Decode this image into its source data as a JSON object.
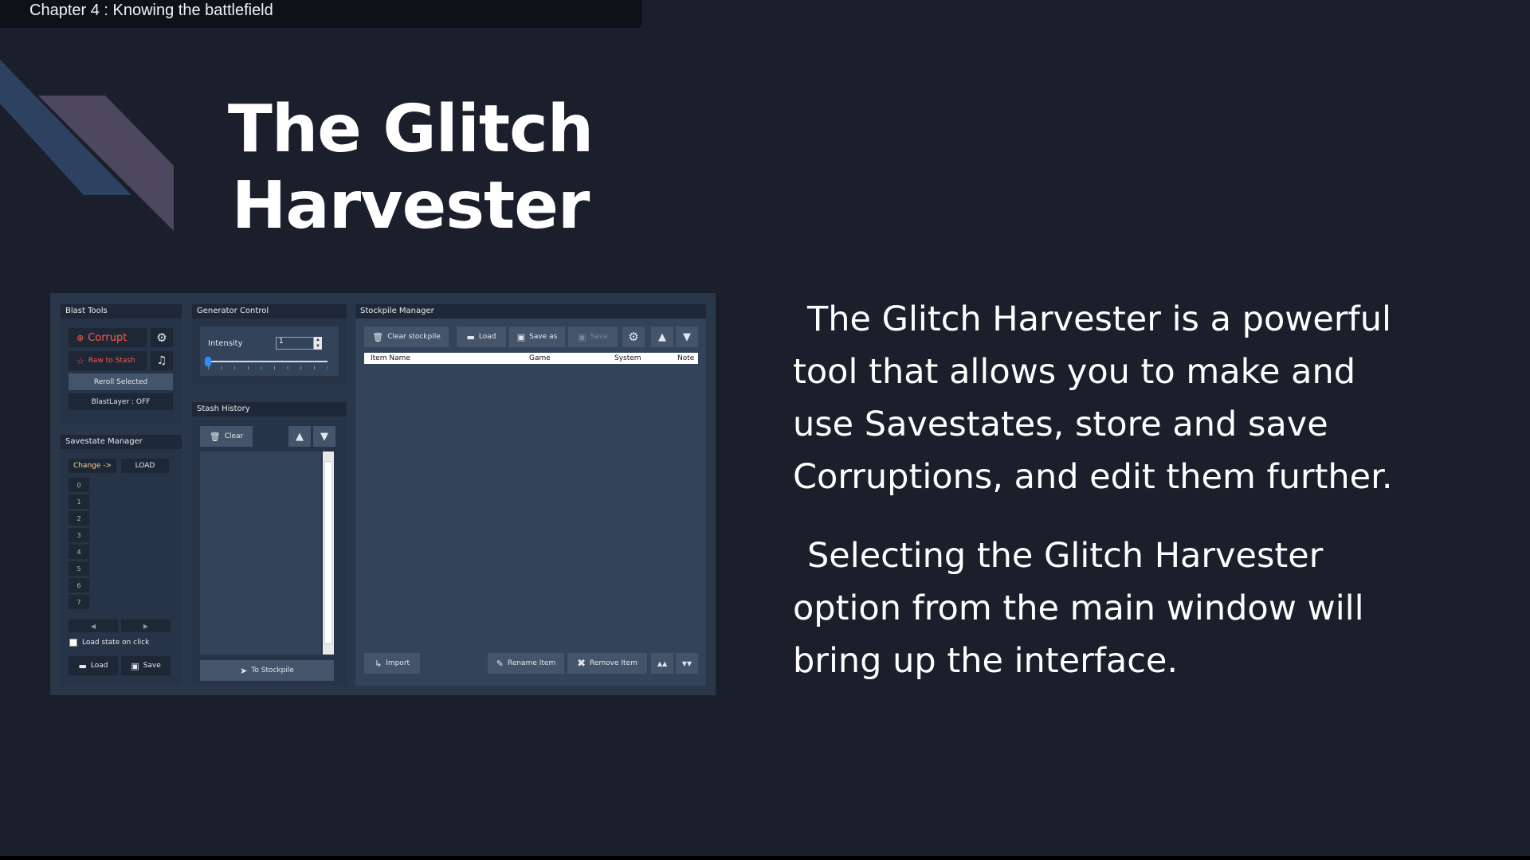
{
  "chapter": "Chapter 4 : Knowing the battlefield",
  "title_line1": "The Glitch",
  "title_line2": "Harvester",
  "paragraphs": [
    "The Glitch Harvester is a powerful tool that allows you to make and use Savestates, store and save Corruptions, and edit them further.",
    "Selecting the Glitch Harvester option from the main window will bring up the interface."
  ],
  "app": {
    "blast_tools": {
      "header": "Blast Tools",
      "corrupt": "Corrupt",
      "raw_to_stash": "Raw to Stash",
      "reroll": "Reroll Selected",
      "blastlayer": "BlastLayer : OFF"
    },
    "generator": {
      "header": "Generator Control",
      "intensity_label": "Intensity",
      "intensity_value": "1",
      "slider_level": 0
    },
    "stash": {
      "header": "Stash History",
      "clear": "Clear",
      "to_stockpile": "To Stockpile"
    },
    "savestate": {
      "header": "Savestate Manager",
      "change": "Change ->",
      "load_caps": "LOAD",
      "slots": [
        "0",
        "1",
        "2",
        "3",
        "4",
        "5",
        "6",
        "7"
      ],
      "prev": "◀",
      "next": "▶",
      "load_on_click": "Load state on click",
      "load": "Load",
      "save": "Save"
    },
    "stockpile": {
      "header": "Stockpile Manager",
      "clear": "Clear stockpile",
      "load": "Load",
      "save_as": "Save as",
      "save": "Save",
      "columns": [
        "Item Name",
        "Game",
        "System",
        "Note"
      ],
      "import": "Import",
      "rename": "Rename Item",
      "remove": "Remove Item"
    }
  }
}
